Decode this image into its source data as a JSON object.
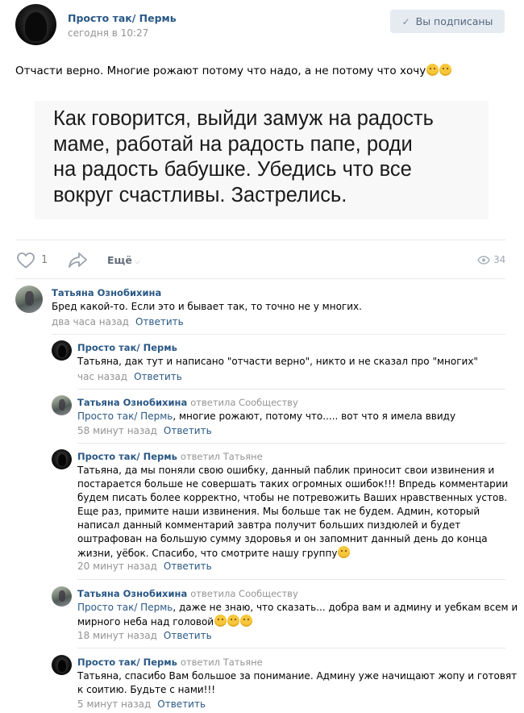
{
  "post": {
    "author": "Просто так/ Пермь",
    "time": "сегодня в 10:27",
    "subscribe_label": "Вы подписаны",
    "text": "Отчасти верно. Многие рожают потому что надо, а не потому что хочу",
    "image_lines": [
      "Как говорится, выйди замуж на радость",
      "маме, работай на радость папе, роди",
      "на радость бабушке. Убедись что все",
      "вокруг счастливы. Застрелись."
    ],
    "likes": "1",
    "more_label": "Ещё",
    "views": "34"
  },
  "reply_label": "Ответить",
  "comments": [
    {
      "author": "Татьяна Ознобихина",
      "lines": [
        "Бред какой-то. Если это и бывает так, то точно не у многих."
      ],
      "time": "два часа назад"
    },
    {
      "author": "Просто так/ Пермь",
      "lines": [
        "Татьяна, дак тут и написано \"отчасти верно\", никто и не сказал про \"многих\""
      ],
      "time": "час назад"
    },
    {
      "author": "Татьяна Ознобихина",
      "replied": "ответила Сообществу",
      "ref": "Просто так/ Пермь",
      "lines": [
        ", многие рожают, потому что..... вот что я имела ввиду"
      ],
      "time": "58 минут назад"
    },
    {
      "author": "Просто так/ Пермь",
      "replied": "ответил Татьяне",
      "lines": [
        "Татьяна, да мы поняли свою ошибку, данный паблик приносит свои извинения и",
        "постарается больше не совершать таких огромных ошибок!!! Впредь комментарии",
        "будем писать более корректно, чтобы не потревожить Ваших нравственных устов.",
        "Еще раз, примите наши извинения. Мы больше так не будем. Админ, который",
        "написал данный комментарий завтра получит больших пиздюлей и будет",
        "оштрафован на большую сумму здоровья и он запомнит данный день до конца",
        "жизни, уёбок. Спасибо, что смотрите нашу группу"
      ],
      "time": "20 минут назад"
    },
    {
      "author": "Татьяна Ознобихина",
      "replied": "ответила Сообществу",
      "ref": "Просто так/ Пермь",
      "lines": [
        ", даже не знаю, что сказать... добра вам и админу и уебкам всем и",
        "мирного неба над головой"
      ],
      "time": "18 минут назад"
    },
    {
      "author": "Просто так/ Пермь",
      "replied": "ответил Татьяне",
      "lines": [
        "Татьяна, спасибо Вам большое за понимание. Админу уже начищают жопу и готовят",
        "к соитию. Будьте с нами!!!"
      ],
      "time": "5 минут назад"
    }
  ]
}
